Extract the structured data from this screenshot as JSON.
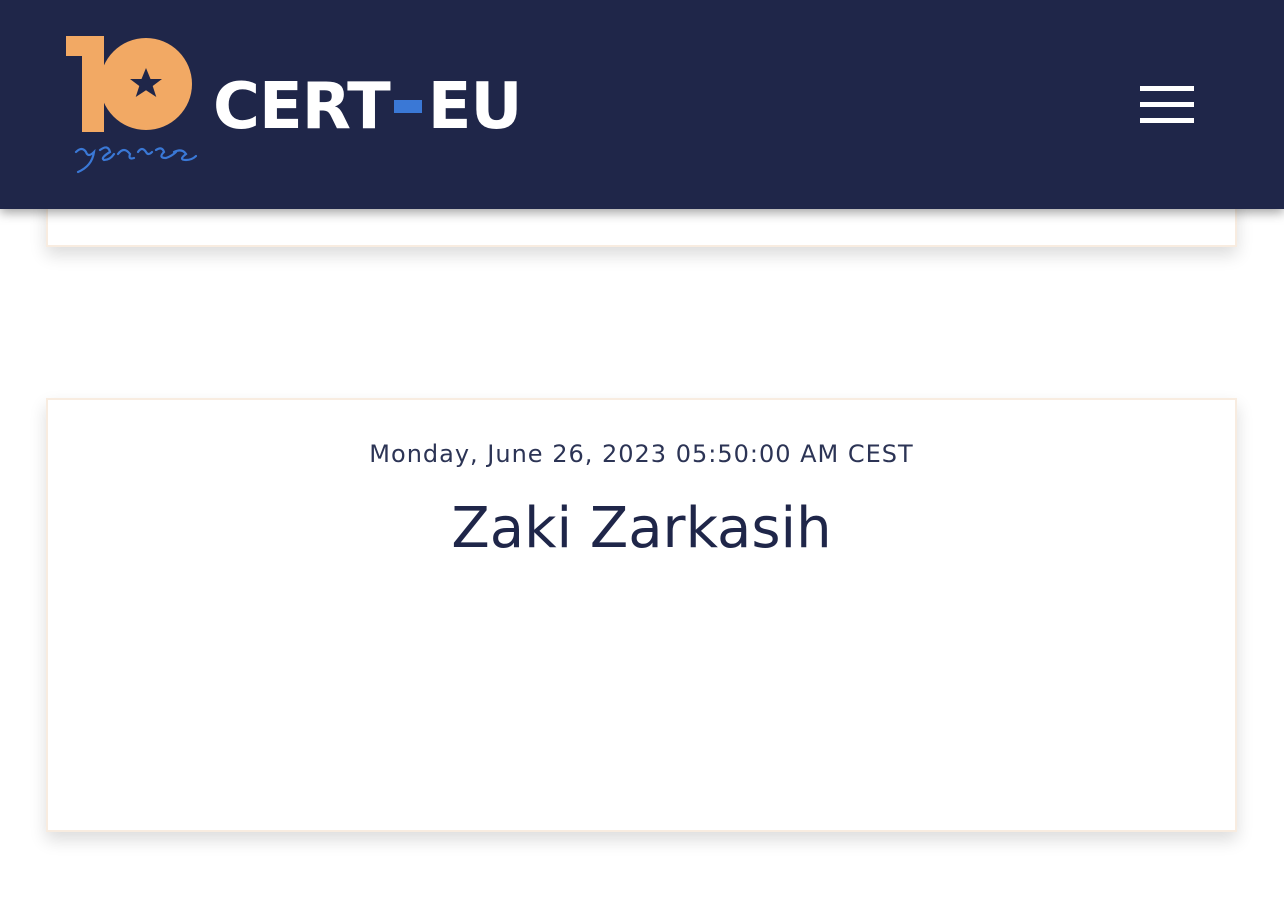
{
  "header": {
    "logo_badge_text": "10 years",
    "logo_text_left": "CERT",
    "logo_text_right": "EU",
    "menu_icon": "hamburger-menu-icon"
  },
  "colors": {
    "header_bg": "#1f2649",
    "logo_accent_orange": "#f2a964",
    "logo_accent_blue": "#3a78d6",
    "text_dark": "#1f2649"
  },
  "event": {
    "date": "Monday, June 26, 2023 05:50:00 AM CEST",
    "speaker": "Zaki Zarkasih"
  }
}
